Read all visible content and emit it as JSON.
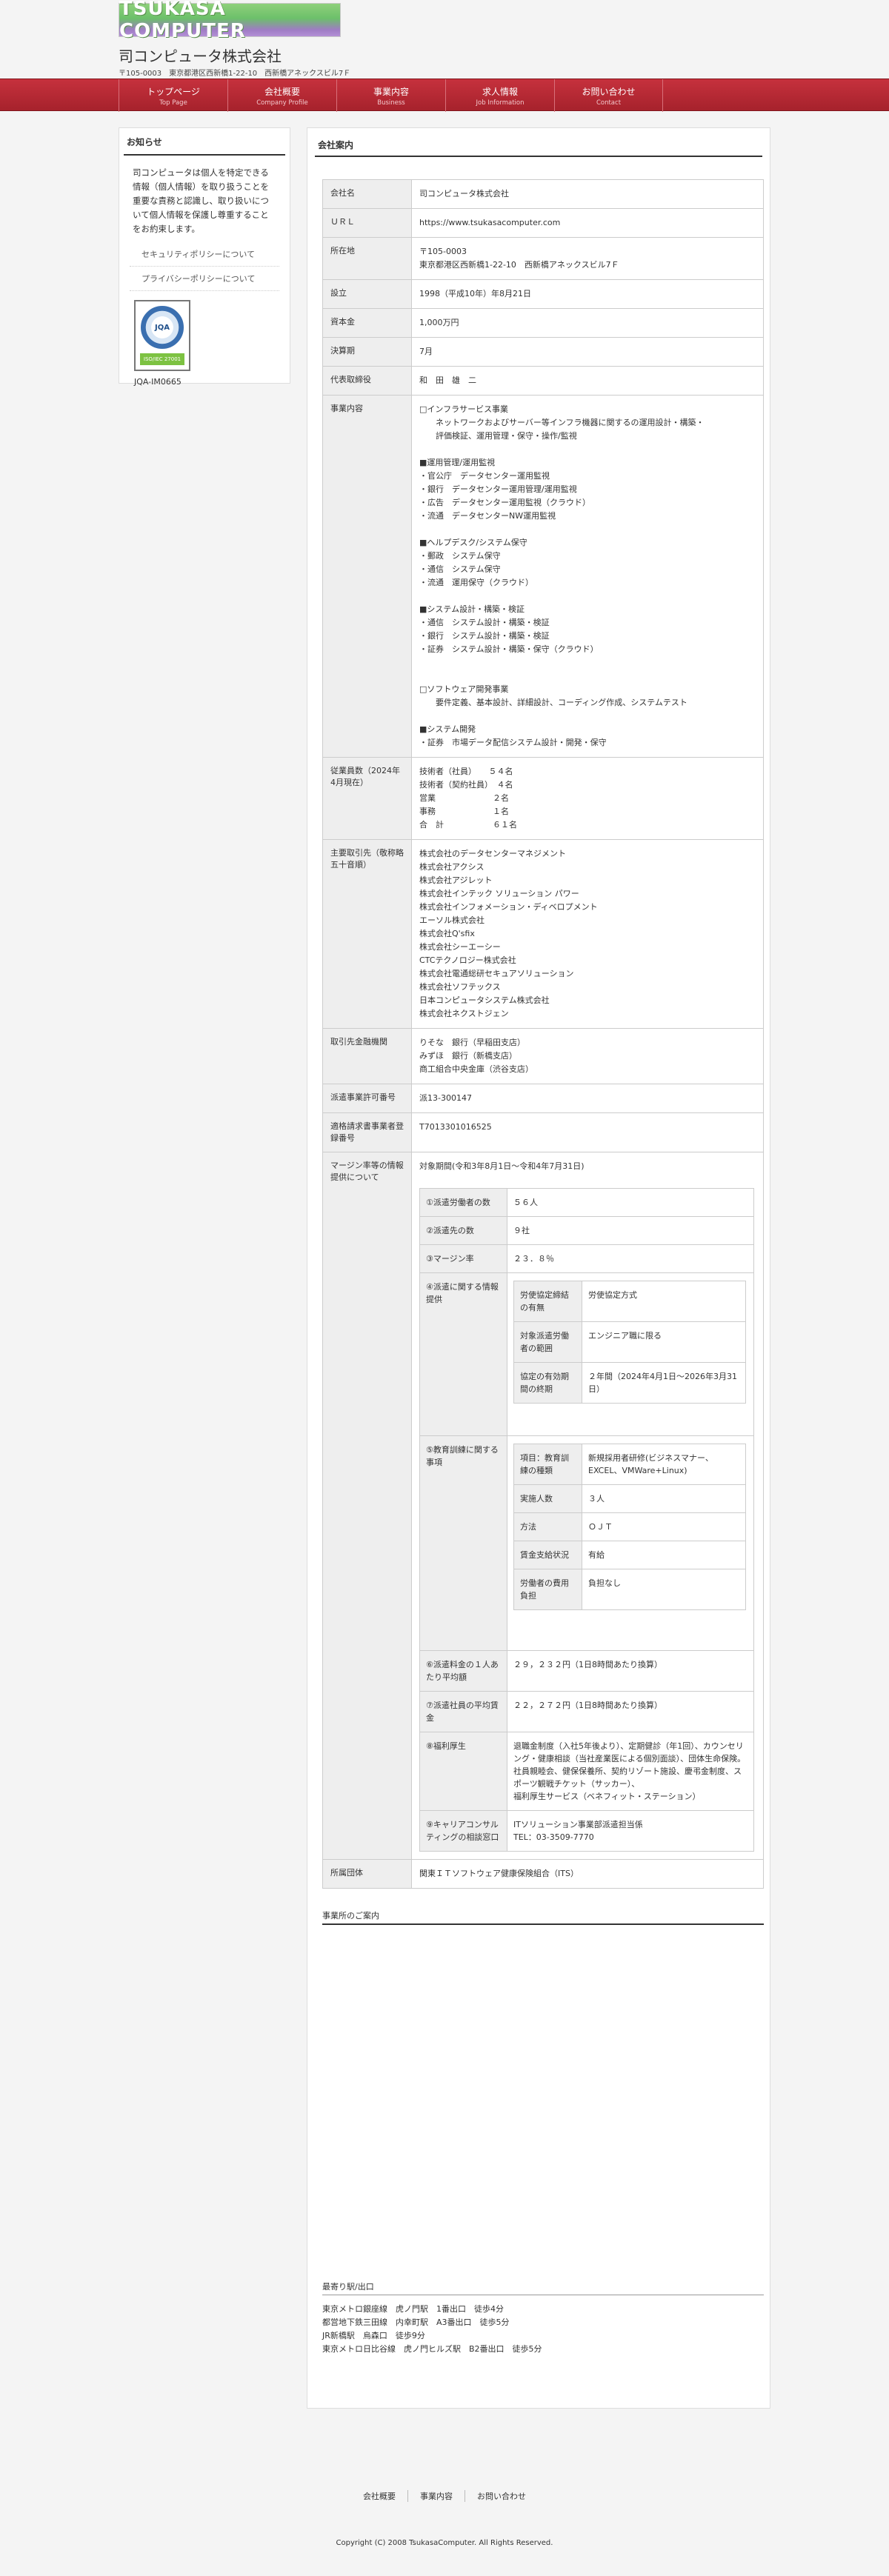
{
  "header": {
    "logo_text": "TSUKASA COMPUTER",
    "company_name": "司コンピュータ株式会社",
    "address": "〒105-0003　東京都港区西新橋1-22-10　西新橋アネックスビル7Ｆ"
  },
  "nav": [
    {
      "jp": "トップページ",
      "en": "Top Page"
    },
    {
      "jp": "会社概要",
      "en": "Company Profile"
    },
    {
      "jp": "事業内容",
      "en": "Business"
    },
    {
      "jp": "求人情報",
      "en": "Job Information"
    },
    {
      "jp": "お問い合わせ",
      "en": "Contact"
    }
  ],
  "sidebar": {
    "title": "お知らせ",
    "text": "司コンピュータは個人を特定できる情報（個人情報）を取り扱うことを重要な責務と認識し、取り扱いについて個人情報を保護し尊重することをお約束します。",
    "links": [
      "セキュリティポリシーについて",
      "プライバシーポリシーについて"
    ],
    "badge_label": "JQA",
    "badge_sub": "ISO/IEC 27001",
    "badge_code": "JQA-IM0665"
  },
  "main": {
    "title": "会社案内",
    "rows": {
      "name": {
        "label": "会社名",
        "value": "司コンピュータ株式会社"
      },
      "url": {
        "label": "ＵＲＬ",
        "value": "https://www.tsukasacomputer.com"
      },
      "address": {
        "label": "所在地",
        "value": "〒105-0003\n東京都港区西新橋1-22-10　西新橋アネックスビル7Ｆ"
      },
      "founded": {
        "label": "設立",
        "value": "1998（平成10年）年8月21日"
      },
      "capital": {
        "label": "資本金",
        "value": "1,000万円"
      },
      "fiscal": {
        "label": "決算期",
        "value": "7月"
      },
      "ceo": {
        "label": "代表取締役",
        "value": "和　田　雄　二"
      },
      "business": {
        "label": "事業内容",
        "value": "□インフラサービス事業\n　　ネットワークおよびサーバー等インフラ機器に関するの運用設計・構築・\n　　評価検証、運用管理・保守・操作/監視\n\n■運用管理/運用監視\n・官公庁　データセンター運用監視\n・銀行　データセンター運用管理/運用監視\n・広告　データセンター運用監視（クラウド）\n・流通　データセンターNW運用監視\n\n■ヘルプデスク/システム保守\n・郵政　システム保守\n・通信　システム保守\n・流通　運用保守（クラウド）\n\n■システム設計・構築・検証\n・通信　システム設計・構築・検証\n・銀行　システム設計・構築・検証\n・証券　システム設計・構築・保守（クラウド）\n\n\n□ソフトウェア開発事業\n　　要件定義、基本設計、詳細設計、コーディング作成、システムテスト\n\n■システム開発\n・証券　市場データ配信システム設計・開発・保守"
      },
      "employees": {
        "label": "従業員数（2024年4月現在）",
        "value": "技術者（社員）　　５４名\n技術者（契約社員）　４名\n営業　　　　　　　２名\n事務　　　　　　　１名\n合　計　　　　　　６１名"
      },
      "clients": {
        "label": "主要取引先（敬称略　五十音順）",
        "value": "株式会社のデータセンターマネジメント\n株式会社アクシス\n株式会社アジレット\n株式会社インテック ソリューション パワー\n株式会社インフォメーション・ディベロプメント\nエーソル株式会社\n株式会社Q'sfix\n株式会社シーエーシー\nCTCテクノロジー株式会社\n株式会社電通総研セキュアソリューション\n株式会社ソフテックス\n日本コンピュータシステム株式会社\n株式会社ネクストジェン"
      },
      "banks": {
        "label": "取引先金融機関",
        "value": "りそな　銀行（早稲田支店）\nみずほ　銀行（新橋支店）\n商工組合中央金庫（渋谷支店）"
      },
      "dispatch": {
        "label": "派遣事業許可番号",
        "value": "派13-300147"
      },
      "invoice": {
        "label": "適格請求書事業者登録番号",
        "value": "T7013301016525"
      },
      "margin": {
        "label": "マージン率等の情報提供について",
        "value": "対象期間(令和3年8月1日～令和4年7月31日)"
      },
      "association": {
        "label": "所属団体",
        "value": "関東ＩＴソフトウェア健康保険組合（ITS）"
      }
    },
    "margin_table": {
      "workers": {
        "label": "①派遣労働者の数",
        "value": "５６人"
      },
      "clients": {
        "label": "②派遣先の数",
        "value": "９社"
      },
      "rate": {
        "label": "③マージン率",
        "value": "２３．８％"
      },
      "info": {
        "label": "④派遣に関する情報提供"
      },
      "info_rows": [
        {
          "label": "労使協定締結の有無",
          "value": "労使協定方式"
        },
        {
          "label": "対象派遣労働者の範囲",
          "value": "エンジニア職に限る"
        },
        {
          "label": "協定の有効期間の終期",
          "value": "２年間（2024年4月1日～2026年3月31日）"
        }
      ],
      "training": {
        "label": "⑤教育訓練に関する事項"
      },
      "training_rows": [
        {
          "label": "項目：教育訓練の種類",
          "value": "新規採用者研修(ビジネスマナー、EXCEL、VMWare+Linux)"
        },
        {
          "label": "実施人数",
          "value": "３人"
        },
        {
          "label": "方法",
          "value": "ＯＪＴ"
        },
        {
          "label": "賃金支給状況",
          "value": "有給"
        },
        {
          "label": "労働者の費用負担",
          "value": "負担なし"
        }
      ],
      "wage": {
        "label": "⑥派遣料金の１人あたり平均額",
        "value": "２９，２３２円（1日8時間あたり換算）"
      },
      "salary": {
        "label": "⑦派遣社員の平均賃金",
        "value": "２２，２７２円（1日8時間あたり換算）"
      },
      "welfare": {
        "label": "⑧福利厚生",
        "value": "退職金制度（入社5年後より）、定期健診（年1回）、カウンセリング・健康相談（当社産業医による個別面談）、団体生命保険。\n社員親睦会、健保保養所、契約リゾート施設、慶弔金制度、スポーツ観戦チケット（サッカー）、\n福利厚生サービス（ベネフィット・ステーション）"
      },
      "career": {
        "label": "⑨キャリアコンサルティングの相談窓口",
        "value": "ITソリューション事業部派遣担当係\nTEL：03-3509-7770"
      }
    },
    "office_heading": "事業所のご案内",
    "station_heading": "最寄り駅/出口",
    "stations": [
      "東京メトロ銀座線　虎ノ門駅　1番出口　徒歩4分",
      "都営地下鉄三田線　内幸町駅　A3番出口　徒歩5分",
      "JR新橋駅　烏森口　徒歩9分",
      "東京メトロ日比谷線　虎ノ門ヒルズ駅　B2番出口　徒歩5分"
    ]
  },
  "footer": {
    "links": [
      "会社概要",
      "事業内容",
      "お問い合わせ"
    ],
    "copyright": "Copyright (C) 2008 TsukasaComputer. All Rights Reserved."
  }
}
